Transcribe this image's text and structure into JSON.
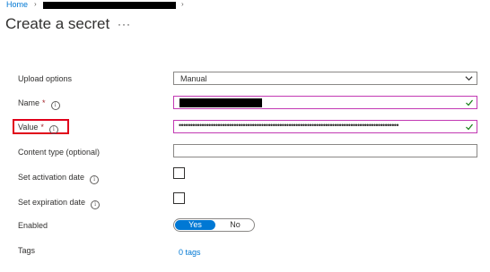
{
  "breadcrumb": {
    "home": "Home",
    "separator": "›"
  },
  "page": {
    "title": "Create a secret",
    "more": "···"
  },
  "form": {
    "upload_options": {
      "label": "Upload options",
      "value": "Manual"
    },
    "name": {
      "label": "Name",
      "required": "*"
    },
    "value": {
      "label": "Value",
      "required": "*",
      "masked": "••••••••••••••••••••••••••••••••••••••••••••••••••••••••••••••••••••••••••••••••••••••••••••••••"
    },
    "content_type": {
      "label": "Content type (optional)"
    },
    "activation": {
      "label": "Set activation date"
    },
    "expiration": {
      "label": "Set expiration date"
    },
    "enabled": {
      "label": "Enabled",
      "yes": "Yes",
      "no": "No"
    },
    "tags": {
      "label": "Tags",
      "link": "0 tags"
    }
  },
  "icons": {
    "info": "info-icon",
    "check": "checkmark-icon",
    "dropdown": "chevron-down-icon"
  },
  "colors": {
    "accent": "#0078d4",
    "valid_border": "#c239b3",
    "valid_check": "#107c10",
    "annotation": "#e0001a",
    "required": "#a4262c"
  }
}
